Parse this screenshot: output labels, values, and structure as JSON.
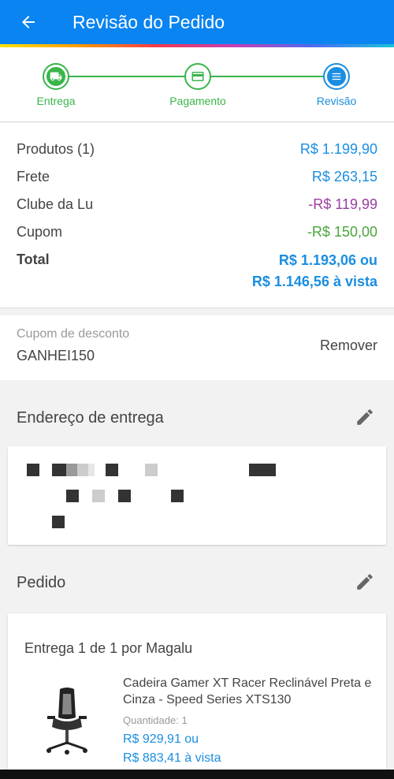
{
  "header": {
    "title": "Revisão do Pedido"
  },
  "steps": [
    {
      "label": "Entrega",
      "icon": "truck-icon",
      "color": "#39b54a"
    },
    {
      "label": "Pagamento",
      "icon": "card-icon",
      "color": "#39b54a"
    },
    {
      "label": "Revisão",
      "icon": "list-icon",
      "color": "#1a8ee0"
    }
  ],
  "summary": {
    "products_label": "Produtos (1)",
    "products_value": "R$ 1.199,90",
    "shipping_label": "Frete",
    "shipping_value": "R$ 263,15",
    "club_label": "Clube da Lu",
    "club_value": "-R$ 119,99",
    "coupon_label": "Cupom",
    "coupon_value": "-R$ 150,00",
    "total_label": "Total",
    "total_value_1": "R$ 1.193,06 ou",
    "total_value_2": "R$ 1.146,56 à vista"
  },
  "coupon": {
    "label": "Cupom de desconto",
    "code": "GANHEI150",
    "remove_label": "Remover"
  },
  "address": {
    "title": "Endereço de entrega"
  },
  "order": {
    "title": "Pedido",
    "delivery_header": "Entrega 1 de 1 por Magalu",
    "product_name": "Cadeira Gamer XT Racer Reclinável Preta e Cinza - Speed Series XTS130",
    "quantity": "Quantidade: 1",
    "price_installment": "R$ 929,91 ou",
    "price_cash": "R$ 883,41 à vista"
  },
  "colors": {
    "primary": "#0a84f0",
    "success": "#39b54a",
    "price": "#1a8ee0",
    "club": "#9b3da3"
  }
}
